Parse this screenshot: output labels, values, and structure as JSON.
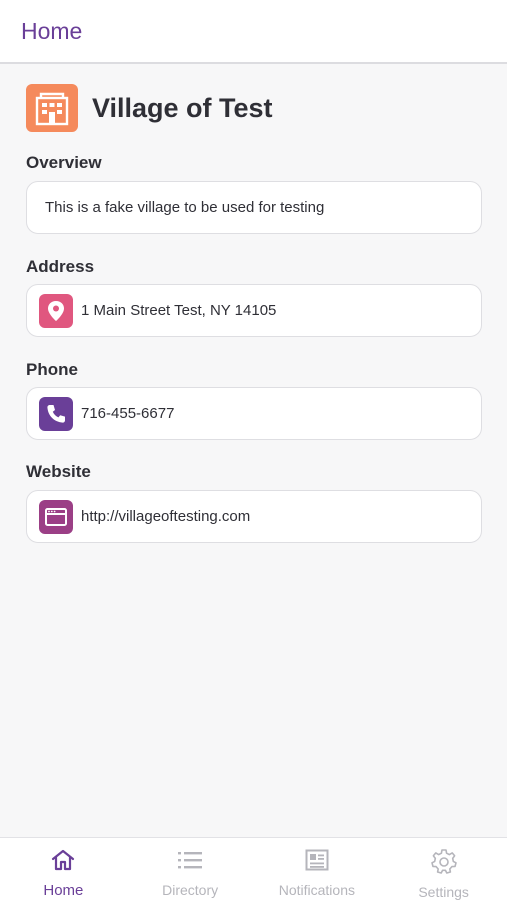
{
  "header": {
    "title": "Home"
  },
  "village": {
    "name": "Village of Test",
    "icon": "building-icon"
  },
  "sections": {
    "overview": {
      "label": "Overview",
      "value": "This is a fake village to be used for testing"
    },
    "address": {
      "label": "Address",
      "value": "1 Main Street Test, NY 14105",
      "icon": "map-pin-icon"
    },
    "phone": {
      "label": "Phone",
      "value": "716-455-6677",
      "icon": "phone-icon"
    },
    "website": {
      "label": "Website",
      "value": "http://villageoftesting.com",
      "icon": "browser-window-icon"
    }
  },
  "tabs": [
    {
      "label": "Home",
      "icon": "home-icon",
      "active": true
    },
    {
      "label": "Directory",
      "icon": "list-icon",
      "active": false
    },
    {
      "label": "Notifications",
      "icon": "newspaper-icon",
      "active": false
    },
    {
      "label": "Settings",
      "icon": "gear-icon",
      "active": false
    }
  ],
  "colors": {
    "brand": "#6a3f98",
    "village_icon": "#f58a5c",
    "address_icon": "#e0577f",
    "phone_icon": "#6a3f98",
    "website_icon": "#9b3f86",
    "inactive_tab": "#b5b5bb"
  }
}
